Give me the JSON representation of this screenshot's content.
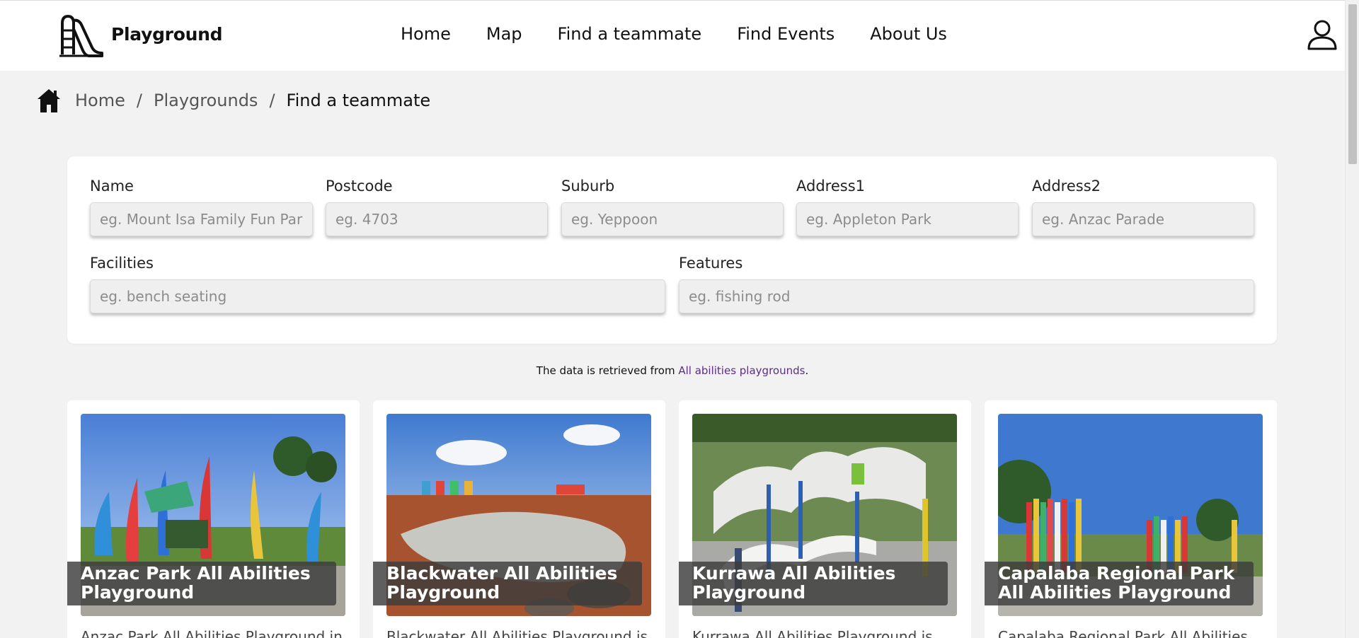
{
  "header": {
    "brand": "Playground",
    "logo_icon": "slide-logo-icon",
    "nav": [
      "Home",
      "Map",
      "Find a teammate",
      "Find Events",
      "About Us"
    ],
    "user_icon": "user-account-icon"
  },
  "breadcrumb": {
    "home_icon": "home-icon",
    "items": [
      "Home",
      "Playgrounds",
      "Find a teammate"
    ]
  },
  "search": {
    "fields": [
      {
        "label": "Name",
        "placeholder": "eg. Mount Isa Family Fun Park",
        "value": ""
      },
      {
        "label": "Postcode",
        "placeholder": "eg. 4703",
        "value": ""
      },
      {
        "label": "Suburb",
        "placeholder": "eg. Yeppoon",
        "value": ""
      },
      {
        "label": "Address1",
        "placeholder": "eg. Appleton Park",
        "value": ""
      },
      {
        "label": "Address2",
        "placeholder": "eg. Anzac Parade",
        "value": ""
      },
      {
        "label": "Facilities",
        "placeholder": "eg. bench seating",
        "value": ""
      },
      {
        "label": "Features",
        "placeholder": "eg. fishing rod",
        "value": ""
      }
    ]
  },
  "note": {
    "prefix": "The data is retrieved from ",
    "link": "All abilities playgrounds",
    "suffix": "."
  },
  "playgrounds": [
    {
      "title": "Anzac Park All Abilities Playground",
      "description": "Anzac Park All Abilities Playground in"
    },
    {
      "title": "Blackwater All Abilities Playground",
      "description": "Blackwater All Abilities Playground is"
    },
    {
      "title": "Kurrawa All Abilities Playground",
      "description": "Kurrawa All Abilities Playground is"
    },
    {
      "title": "Capalaba Regional Park All Abilities Playground",
      "description": "Capalaba Regional Park All Abilities"
    }
  ],
  "colors": {
    "page_bg": "#f2f2f2",
    "card_bg": "#ffffff",
    "link": "#5b2e8a",
    "title_overlay": "#3c3c3c"
  }
}
